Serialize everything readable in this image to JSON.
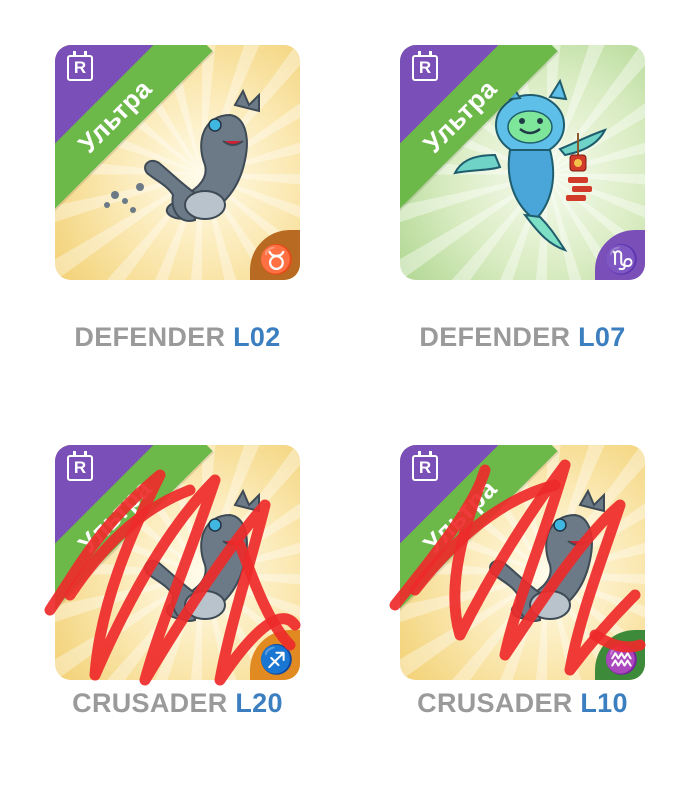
{
  "cards": [
    {
      "theme": "gold",
      "rarity_badge": "R",
      "banner": "Ультра",
      "zodiac_symbol": "♉",
      "zodiac_icon": "taurus-icon",
      "zodiac_color": "#b96a22",
      "creature": "grey-dragon-creature",
      "name": "DEFENDER",
      "level": "L02",
      "crossed_out": false
    },
    {
      "theme": "green",
      "rarity_badge": "R",
      "banner": "Ультра",
      "zodiac_symbol": "♑",
      "zodiac_icon": "capricorn-icon",
      "zodiac_color": "#7b4fb8",
      "creature": "teal-spirit-creature",
      "name": "DEFENDER",
      "level": "L07",
      "crossed_out": false
    },
    {
      "theme": "gold",
      "rarity_badge": "R",
      "banner": "Ультра",
      "zodiac_symbol": "♐",
      "zodiac_icon": "zodiac-icon",
      "zodiac_color": "#e08a21",
      "creature": "grey-dragon-creature",
      "name": "CRUSADER",
      "level": "L20",
      "crossed_out": true
    },
    {
      "theme": "gold",
      "rarity_badge": "R",
      "banner": "Ультра",
      "zodiac_symbol": "♒",
      "zodiac_icon": "zodiac-icon",
      "zodiac_color": "#3d8a3a",
      "creature": "grey-dragon-creature",
      "name": "CRUSADER",
      "level": "L10",
      "crossed_out": true
    }
  ],
  "colors": {
    "ultra_banner": "#6cb94a",
    "rarity_corner": "#7b4fb8",
    "name_text": "#9a9a9a",
    "level_text": "#3c7fc0",
    "scribble": "#ee2a2a"
  }
}
